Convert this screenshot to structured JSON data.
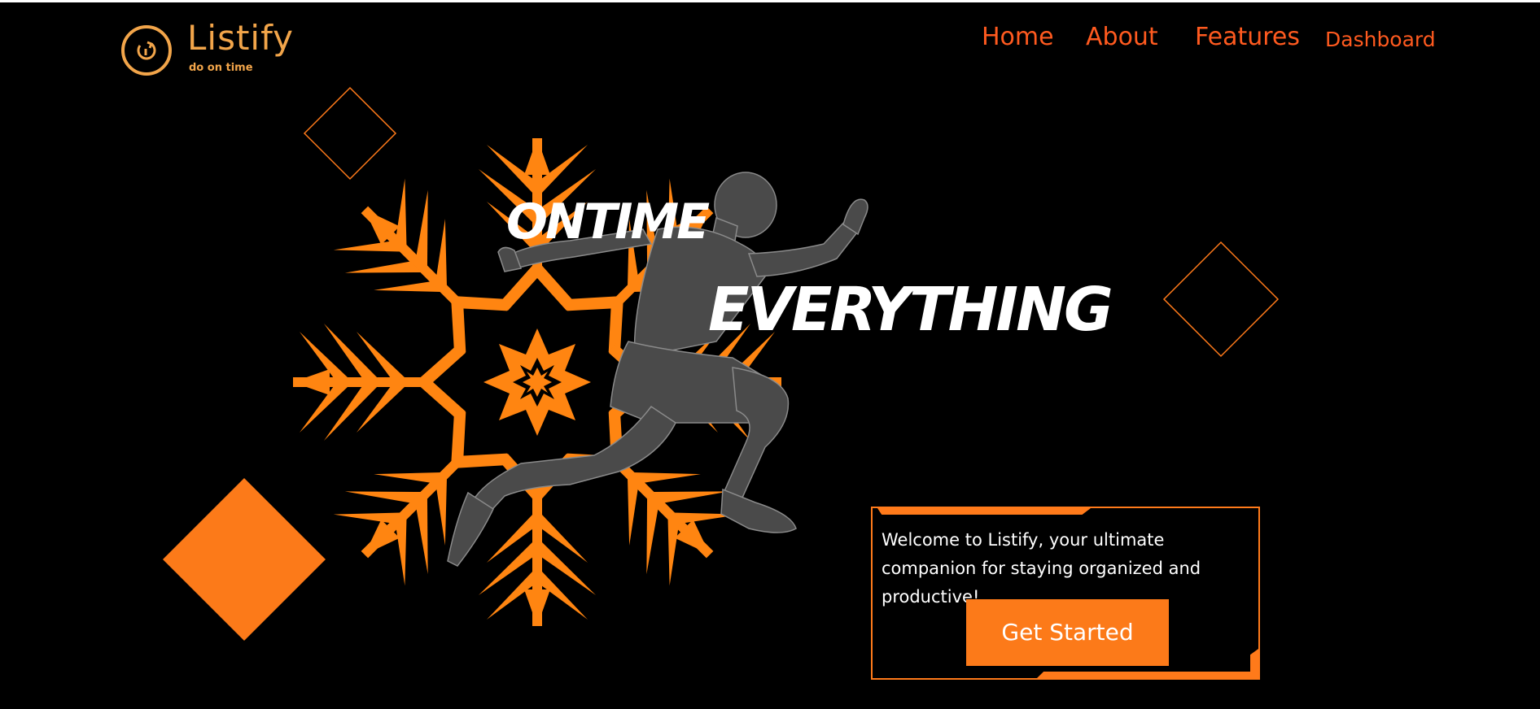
{
  "brand": {
    "name": "Listify",
    "tagline": "do on time",
    "logo_icon": "clock-arrow-icon"
  },
  "nav": {
    "items": [
      {
        "label": "Home"
      },
      {
        "label": "About"
      },
      {
        "label": "Features"
      },
      {
        "label": "Dashboard"
      }
    ]
  },
  "hero": {
    "headline_line1": "ONTIME",
    "headline_line2": "EVERYTHING",
    "illustration": "snowflake-runner-illustration"
  },
  "welcome_card": {
    "text": "Welcome to Listify, your ultimate companion for staying organized and productive!",
    "cta_label": "Get Started"
  },
  "colors": {
    "background": "#000000",
    "accent": "#FF7A1A",
    "brand": "#F2A54A",
    "nav": "#FF5A1F"
  }
}
